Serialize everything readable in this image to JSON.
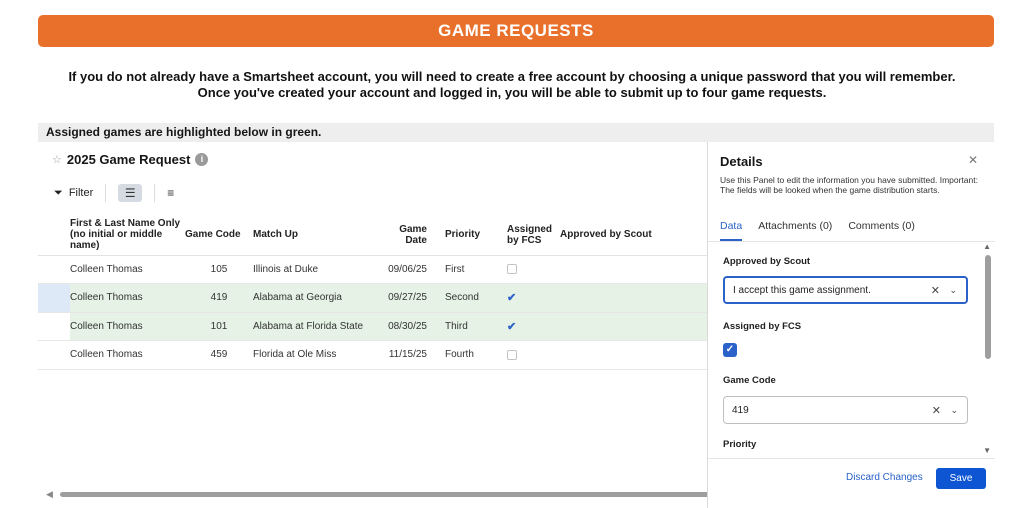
{
  "banner": {
    "title": "GAME REQUESTS"
  },
  "intro": {
    "line1": "If you do not already have a Smartsheet account, you will need to create a free account by choosing a unique password that you will remember.",
    "line2": "Once you've created your account and logged in, you will be able to submit up to four game requests."
  },
  "notice": "Assigned games are highlighted below in green.",
  "sheet": {
    "title": "2025 Game Request",
    "info_glyph": "i",
    "toolbar": {
      "filter_label": "Filter"
    },
    "columns": {
      "name": "First & Last Name Only (no initial or middle name)",
      "code": "Game Code",
      "matchup": "Match Up",
      "date": "Game Date",
      "priority": "Priority",
      "assigned": "Assigned by FCS",
      "approved": "Approved by Scout"
    },
    "rows": [
      {
        "name": "Colleen Thomas",
        "code": "105",
        "matchup": "Illinois at Duke",
        "date": "09/06/25",
        "priority": "First",
        "assigned": false,
        "approved": ""
      },
      {
        "name": "Colleen Thomas",
        "code": "419",
        "matchup": "Alabama at Georgia",
        "date": "09/27/25",
        "priority": "Second",
        "assigned": true,
        "approved": ""
      },
      {
        "name": "Colleen Thomas",
        "code": "101",
        "matchup": "Alabama at Florida State",
        "date": "08/30/25",
        "priority": "Third",
        "assigned": true,
        "approved": ""
      },
      {
        "name": "Colleen Thomas",
        "code": "459",
        "matchup": "Florida at Ole Miss",
        "date": "11/15/25",
        "priority": "Fourth",
        "assigned": false,
        "approved": ""
      }
    ]
  },
  "details": {
    "title": "Details",
    "description": "Use this Panel to edit the information you have submitted. Important: The fields will be looked when the game distribution starts.",
    "tabs": [
      "Data",
      "Attachments (0)",
      "Comments (0)"
    ],
    "fields": {
      "approved_label": "Approved by Scout",
      "approved_value": "I accept this game assignment.",
      "assigned_label": "Assigned by FCS",
      "assigned_checked": true,
      "code_label": "Game Code",
      "code_value": "419",
      "priority_label": "Priority"
    },
    "discard_label": "Discard Changes",
    "save_label": "Save"
  },
  "colors": {
    "banner": "#e8702a",
    "accent": "#2a62c9",
    "highlight_row": "#e5f2e5",
    "save_button": "#0d55d2"
  },
  "icons": [
    "star-icon",
    "info-icon",
    "filter-icon",
    "grid-view-icon",
    "row-height-icon",
    "close-icon",
    "clear-icon",
    "chevron-down-icon",
    "checkmark-icon"
  ]
}
